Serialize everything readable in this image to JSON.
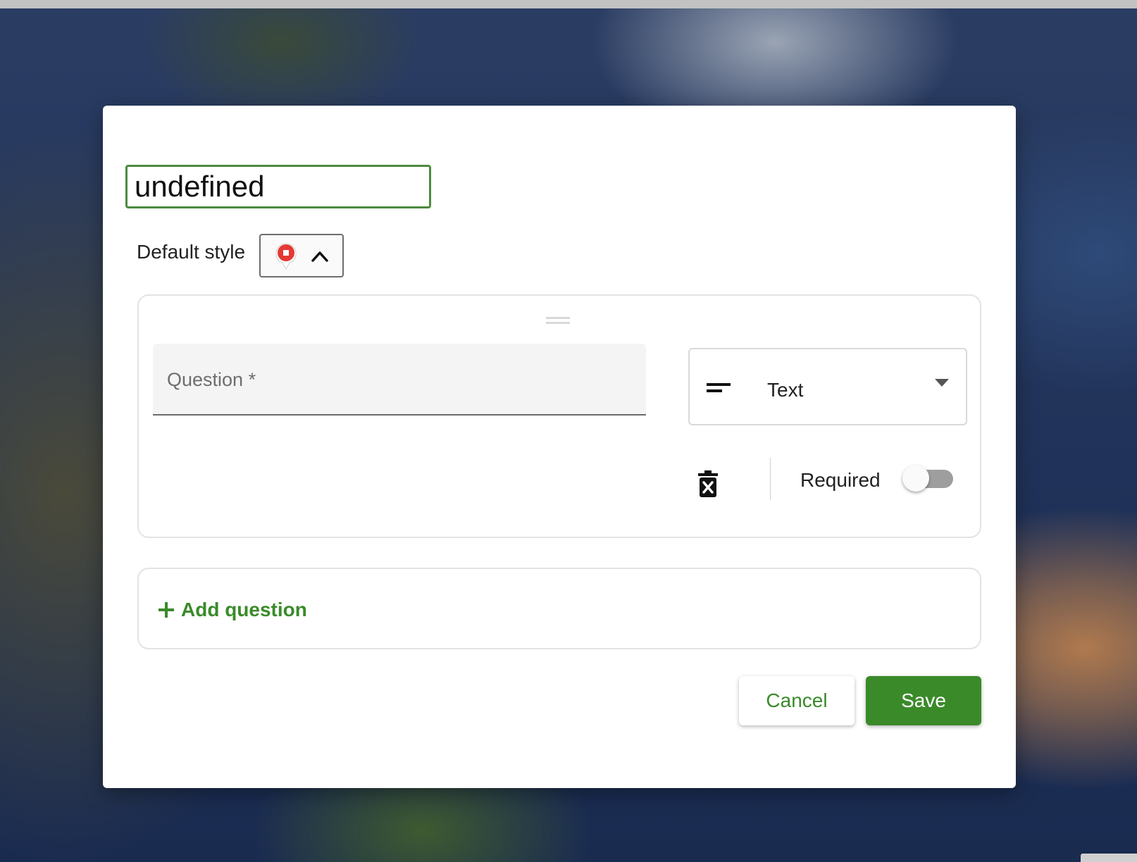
{
  "background": {
    "type": "satellite-map"
  },
  "dialog": {
    "title_value": "undefined",
    "default_style": {
      "label": "Default style",
      "marker_color": "#e53935",
      "marker_icon": "map-marker-icon",
      "toggle_icon": "chevron-up-icon"
    },
    "question": {
      "drag_icon": "drag-handle-icon",
      "placeholder": "Question *",
      "type": {
        "label": "Text",
        "icon": "short-text-icon",
        "dropdown_icon": "arrow-drop-down-icon"
      },
      "delete_icon": "delete-forever-icon",
      "required_label": "Required",
      "required": false
    },
    "add_question": {
      "label": "Add question",
      "icon": "plus-icon"
    },
    "buttons": {
      "cancel": "Cancel",
      "save": "Save"
    },
    "colors": {
      "accent": "#3a8a2a",
      "title_border": "#4c8a3f",
      "marker": "#e53935"
    }
  }
}
